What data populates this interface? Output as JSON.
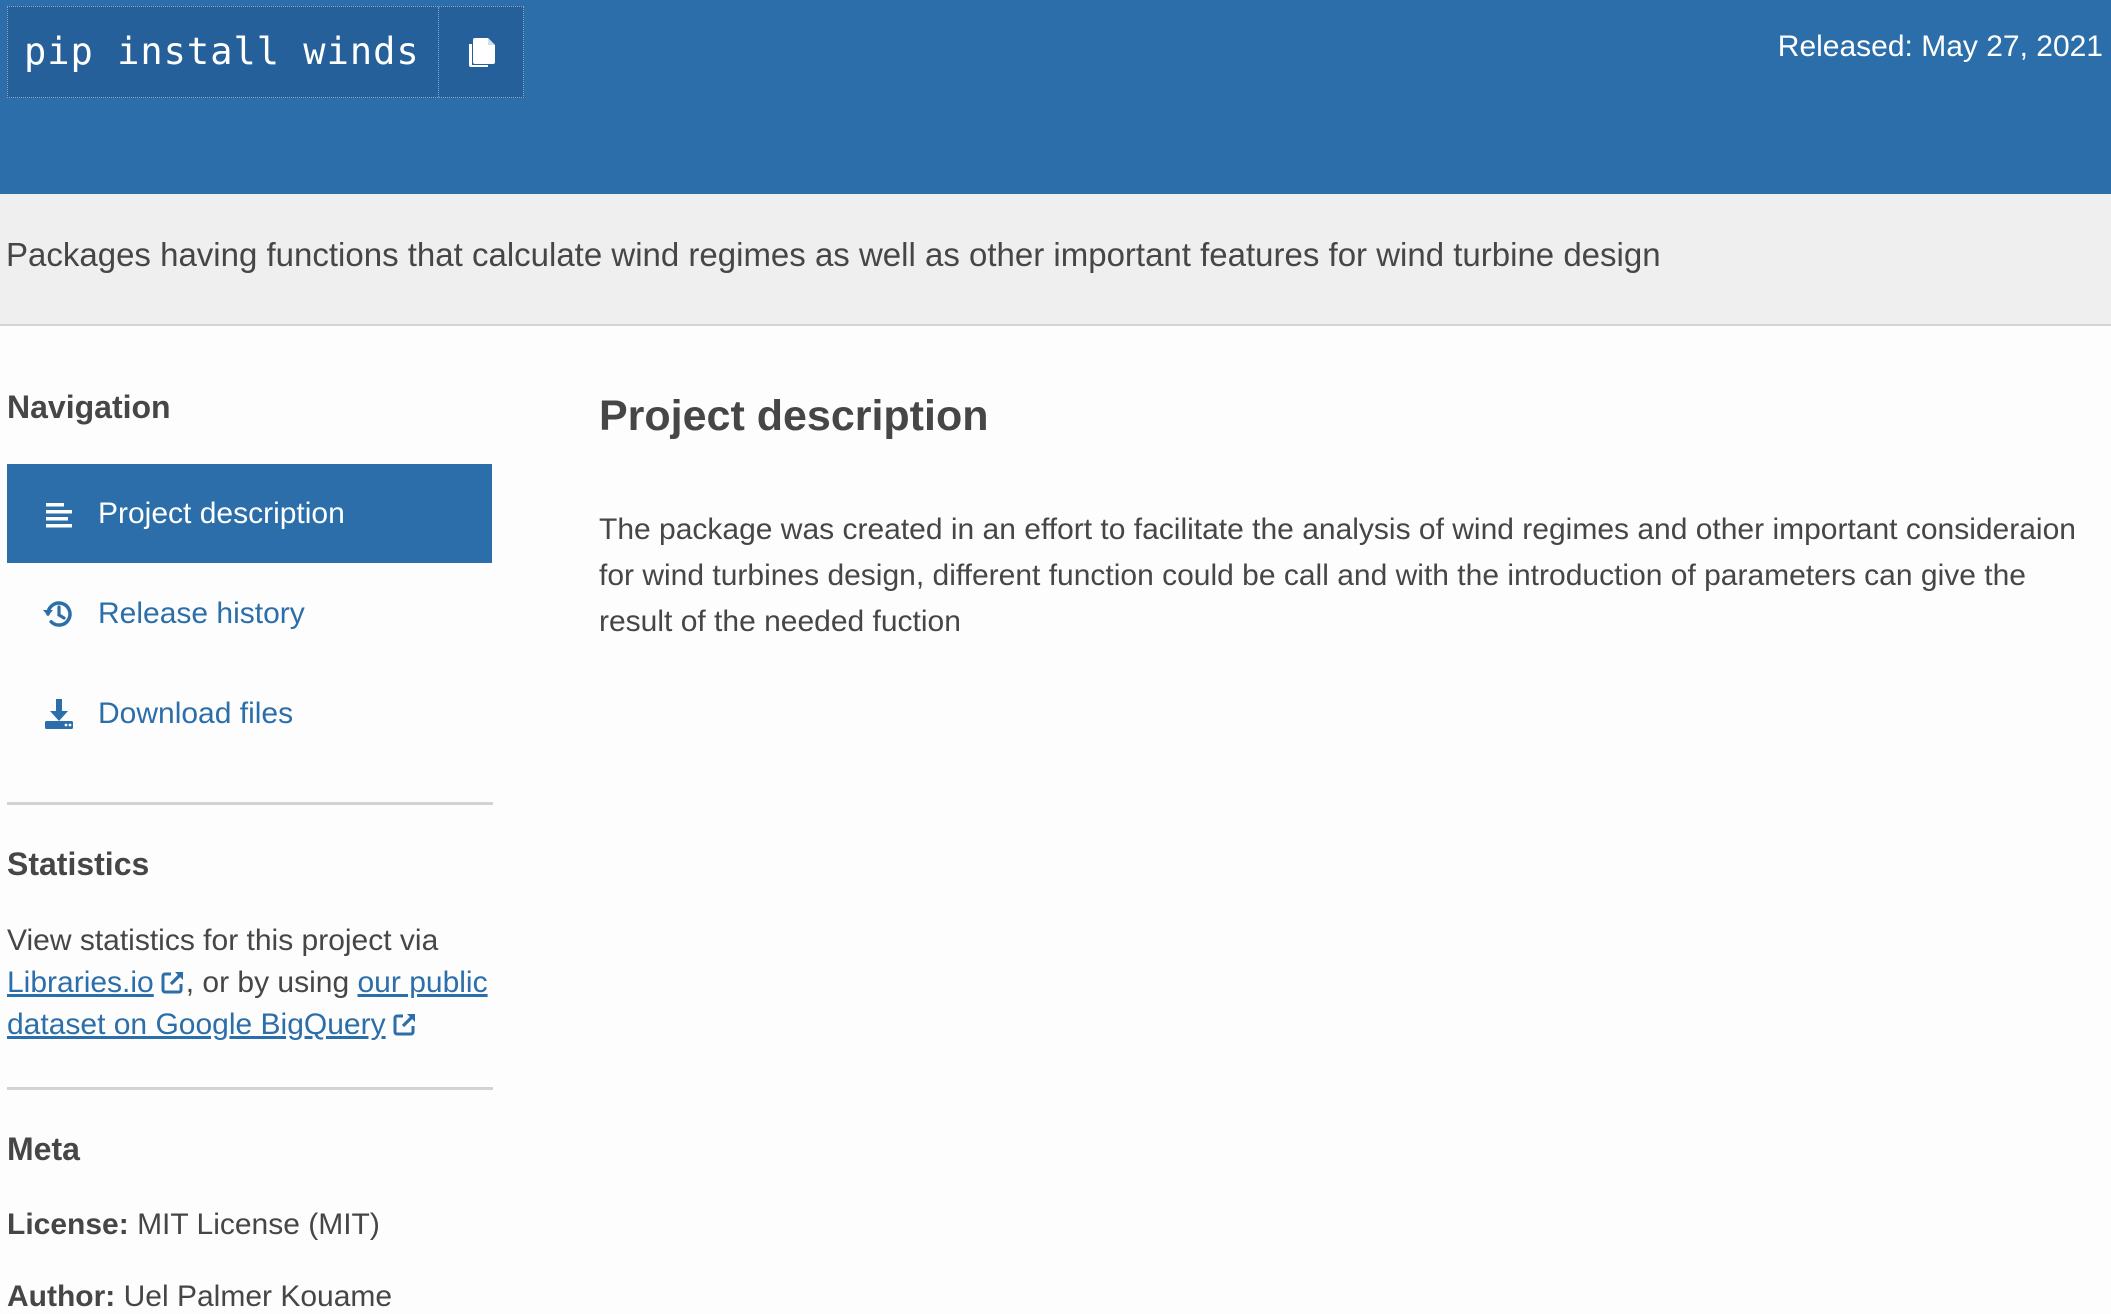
{
  "banner": {
    "pip_command": "pip install winds",
    "copy_icon": "copy-icon",
    "released": "Released: May 27, 2021",
    "color": "#2b6ea9"
  },
  "summary": "Packages having functions that calculate wind regimes as well as other important features for wind turbine design",
  "sidebar": {
    "navigation_heading": "Navigation",
    "nav_items": [
      {
        "label": "Project description",
        "icon": "list-icon",
        "active": true
      },
      {
        "label": "Release history",
        "icon": "history-icon",
        "active": false
      },
      {
        "label": "Download files",
        "icon": "download-icon",
        "active": false
      }
    ],
    "statistics_heading": "Statistics",
    "statistics": {
      "prefix": "View statistics for this project via",
      "link1": "Libraries.io",
      "middle": ", or by using",
      "link2": "our public dataset on Google BigQuery"
    },
    "meta_heading": "Meta",
    "meta": {
      "license_label": "License:",
      "license_value": "MIT License (MIT)",
      "author_label": "Author:",
      "author_value": "Uel Palmer Kouame"
    }
  },
  "main": {
    "title": "Project description",
    "body": "The package was created in an effort to facilitate the analysis of wind regimes and other important consideraion for wind turbines design, different function could be call and with the introduction of parameters can give the result of the needed fuction"
  }
}
